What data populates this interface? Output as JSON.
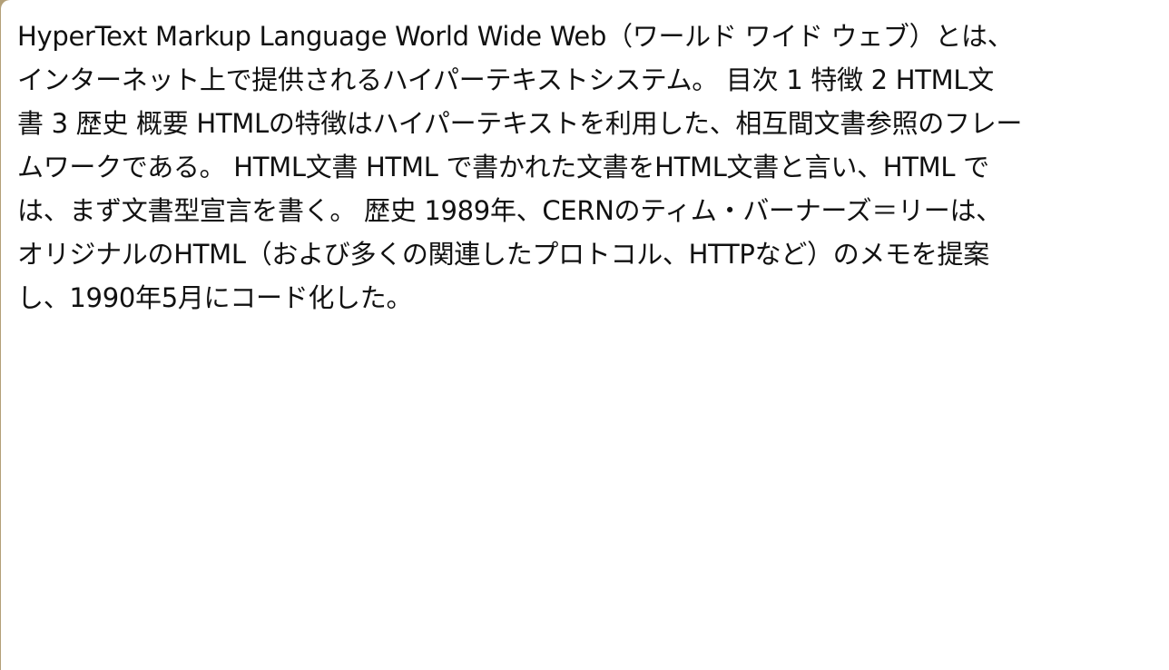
{
  "document": {
    "lines": [
      "HyperText Markup Language World Wide Web（ワールド ワイド ウェブ）とは、",
      "インターネット上で提供されるハイパーテキストシステム。 目次  1 特徴 2 HTML文",
      "書 3 歴史 概要 HTMLの特徴はハイパーテキストを利用した、相互間文書参照のフレー",
      "ムワークである。 HTML文書 HTML で書かれた文書をHTML文書と言い、HTML で",
      "は、まず文書型宣言を書く。 歴史 1989年、CERNのティム・バーナーズ＝リーは、",
      "オリジナルのHTML（および多くの関連したプロトコル、HTTPなど）のメモを提案",
      "し、1990年5月にコード化した。"
    ]
  }
}
